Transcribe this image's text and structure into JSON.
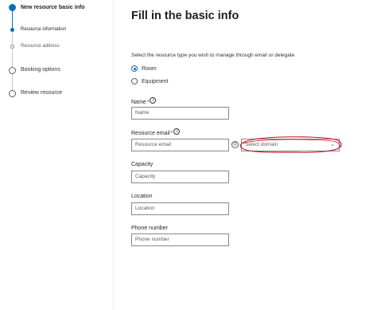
{
  "sidebar": {
    "steps": [
      {
        "label": "New resource basic info",
        "level": 1,
        "current": true
      },
      {
        "label": "Resource information",
        "level": 2,
        "current": true
      },
      {
        "label": "Resource address",
        "level": 2,
        "current": false
      },
      {
        "label": "Booking options",
        "level": 1,
        "current": false
      },
      {
        "label": "Review resource",
        "level": 1,
        "current": false
      }
    ]
  },
  "main": {
    "title": "Fill in the basic info",
    "intro": "Select the resource type you wish to manage through email or delegate",
    "resource_types": [
      {
        "label": "Room",
        "checked": true
      },
      {
        "label": "Equipment",
        "checked": false
      }
    ],
    "fields": {
      "name": {
        "label": "Name",
        "required_mark": "*",
        "placeholder": "Name"
      },
      "email": {
        "label": "Resource email",
        "required_mark": "*",
        "placeholder": "Resource email",
        "at_symbol": "@"
      },
      "domain": {
        "placeholder": "Select domain",
        "chevron": "⌄"
      },
      "capacity": {
        "label": "Capacity",
        "placeholder": "Capacity"
      },
      "location": {
        "label": "Location",
        "placeholder": "Location"
      },
      "phone": {
        "label": "Phone number",
        "placeholder": "Phone number"
      }
    },
    "info_icon_glyph": "i",
    "icons": {
      "info": "info-icon",
      "at": "at-sign-icon",
      "chevron": "chevron-down-icon"
    }
  },
  "colors": {
    "accent": "#0f6cbd",
    "annotation": "#c50f1f",
    "required": "#a4262c"
  }
}
